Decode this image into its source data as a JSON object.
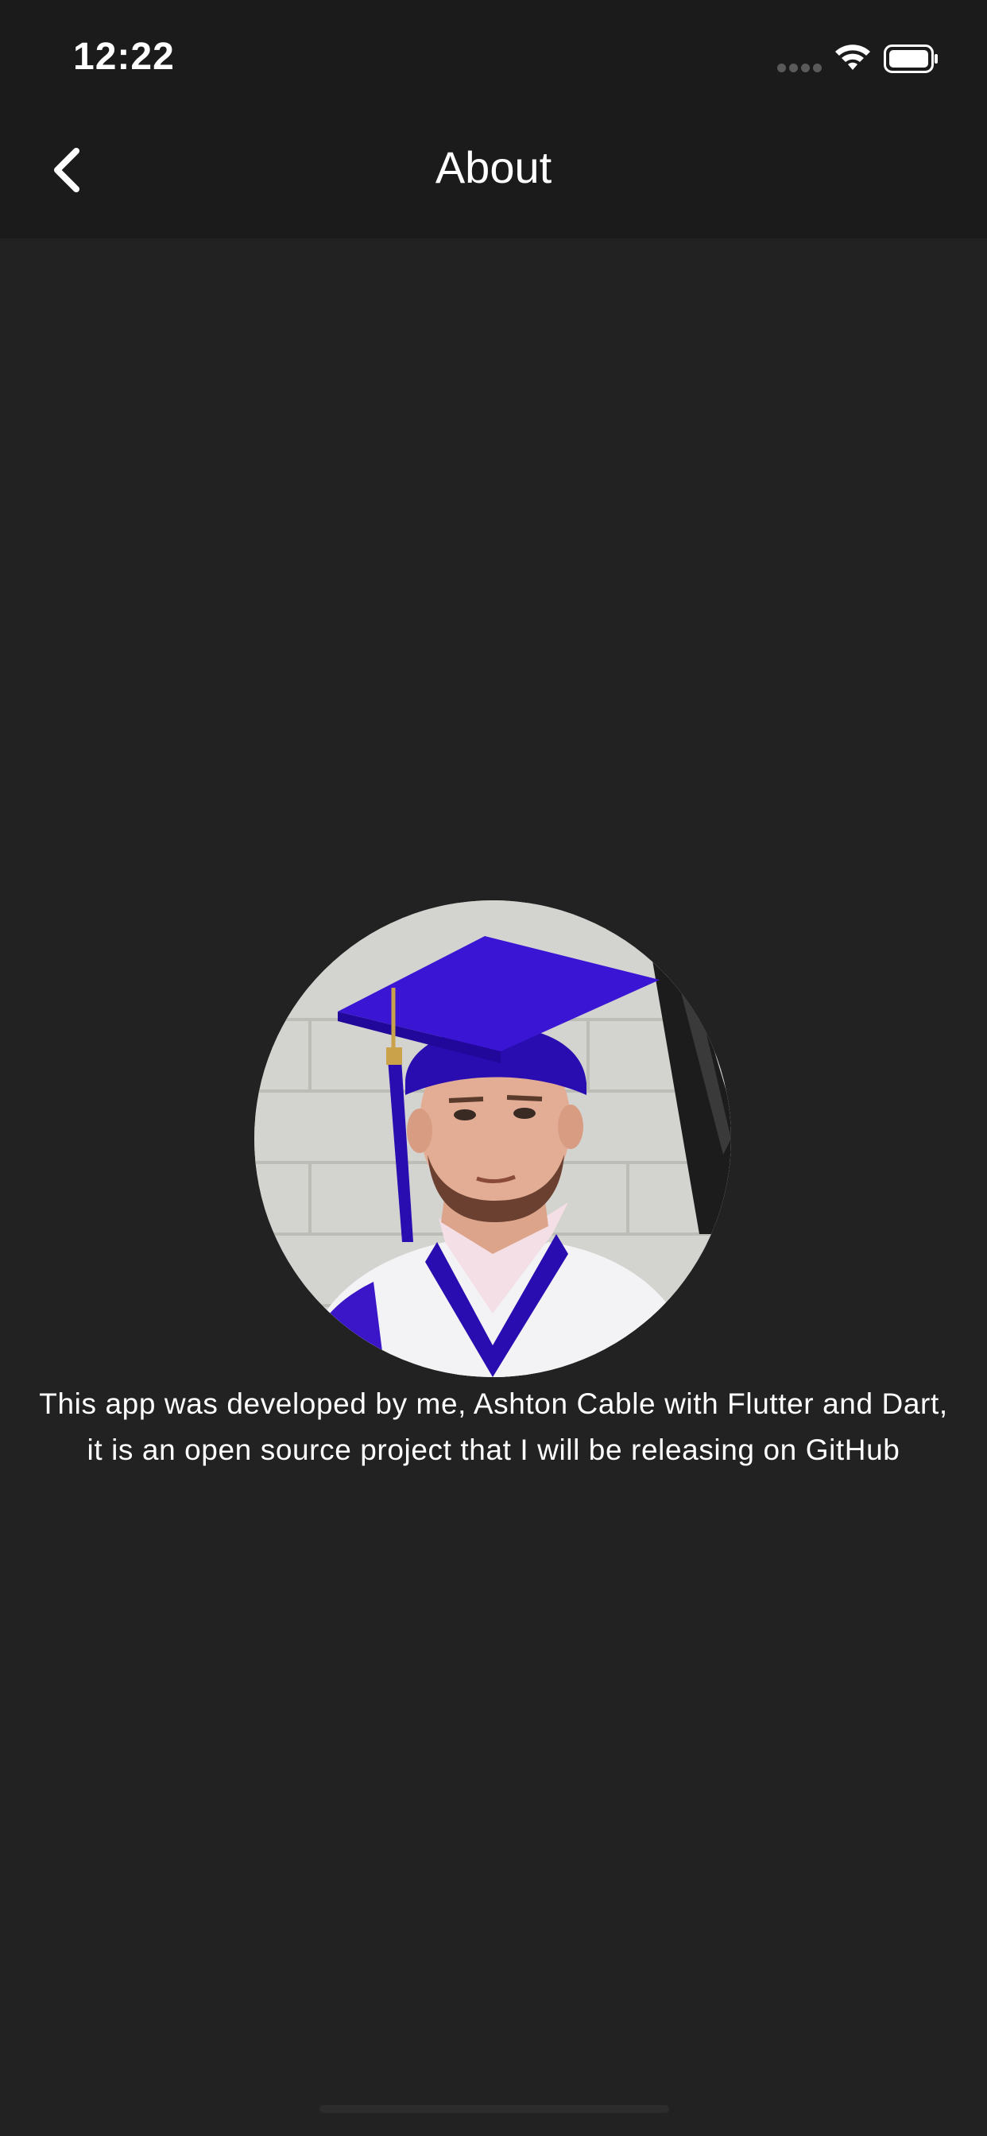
{
  "status_bar": {
    "time": "12:22",
    "icons": [
      "signal-dots-icon",
      "wifi-icon",
      "battery-icon"
    ]
  },
  "nav_bar": {
    "title": "About",
    "back_icon": "chevron-left-icon"
  },
  "profile": {
    "avatar_alt": "graduation portrait",
    "description": "This app was developed by me, Ashton Cable with Flutter and Dart,\nit is an open source project that I will be releasing on GitHub"
  },
  "colors": {
    "background": "#222222",
    "app_bar": "#1b1b1b",
    "text": "#ffffff",
    "cap_purple": "#2a0db0"
  }
}
